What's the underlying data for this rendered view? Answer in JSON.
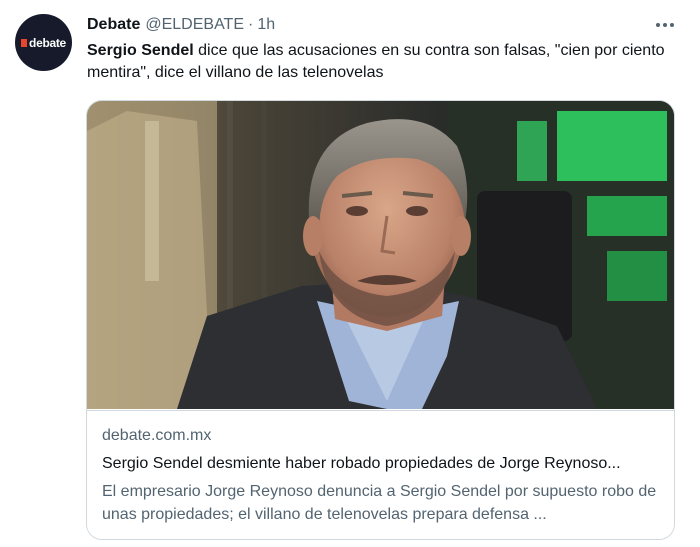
{
  "tweet": {
    "author_name": "Debate",
    "author_handle": "@ELDEBATE",
    "separator": "·",
    "time": "1h",
    "avatar_text": "debate",
    "text_bold": "Sergio Sendel",
    "text_rest": " dice que las acusaciones en su contra son falsas, \"cien por ciento mentira\", dice el villano de las telenovelas"
  },
  "card": {
    "domain": "debate.com.mx",
    "title": "Sergio Sendel desmiente haber robado propiedades de Jorge Reynoso...",
    "description": "El empresario Jorge Reynoso denuncia a Sergio Sendel por supuesto robo de unas propiedades; el villano de telenovelas prepara defensa ..."
  },
  "colors": {
    "text_primary": "#0f1419",
    "text_secondary": "#536471",
    "border": "#cfd9de",
    "avatar_bg": "#161a2a",
    "brand_accent": "#e8452c"
  },
  "icons": {
    "more": "more-dots-icon"
  }
}
